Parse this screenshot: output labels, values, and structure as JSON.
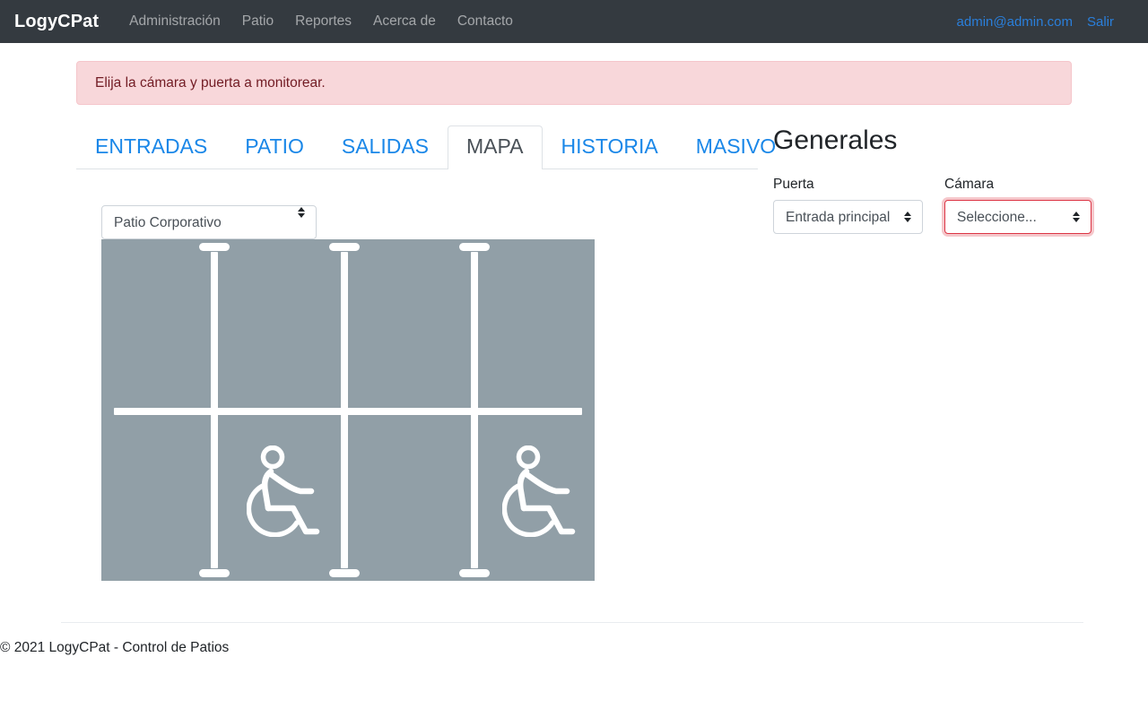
{
  "navbar": {
    "brand": "LogyCPat",
    "links": [
      {
        "label": "Administración"
      },
      {
        "label": "Patio"
      },
      {
        "label": "Reportes"
      },
      {
        "label": "Acerca de"
      },
      {
        "label": "Contacto"
      }
    ],
    "user_email": "admin@admin.com",
    "logout_label": "Salir"
  },
  "alert": {
    "message": "Elija la cámara y puerta a monitorear.",
    "bg_color": "#f8d7da",
    "text_color": "#721c24",
    "border_color": "#f5c6cb"
  },
  "tabs": [
    {
      "label": "ENTRADAS",
      "active": false
    },
    {
      "label": "PATIO",
      "active": false
    },
    {
      "label": "SALIDAS",
      "active": false
    },
    {
      "label": "MAPA",
      "active": true
    },
    {
      "label": "HISTORIA",
      "active": false
    },
    {
      "label": "MASIVO",
      "active": false
    }
  ],
  "patio_select": {
    "value": "Patio Corporativo",
    "options": [
      "Patio Corporativo"
    ]
  },
  "map": {
    "alt": "Mapa de patio de estacionamiento",
    "background_color": "#919fa7",
    "line_color": "#ffffff",
    "accessible_spaces": 2,
    "divider_count": 3
  },
  "panel": {
    "title": "Generales",
    "puerta": {
      "label": "Puerta",
      "value": "Entrada principal",
      "options": [
        "Entrada principal"
      ]
    },
    "camara": {
      "label": "Cámara",
      "value": "Seleccione...",
      "options": [
        "Seleccione..."
      ],
      "invalid": true,
      "error_color": "#dc3545"
    }
  },
  "footer": {
    "text": "© 2021 LogyCPat - Control de Patios"
  },
  "theme": {
    "navbar_bg": "#343a40",
    "link_blue": "#1a87e8",
    "page_bg": "#ffffff"
  }
}
